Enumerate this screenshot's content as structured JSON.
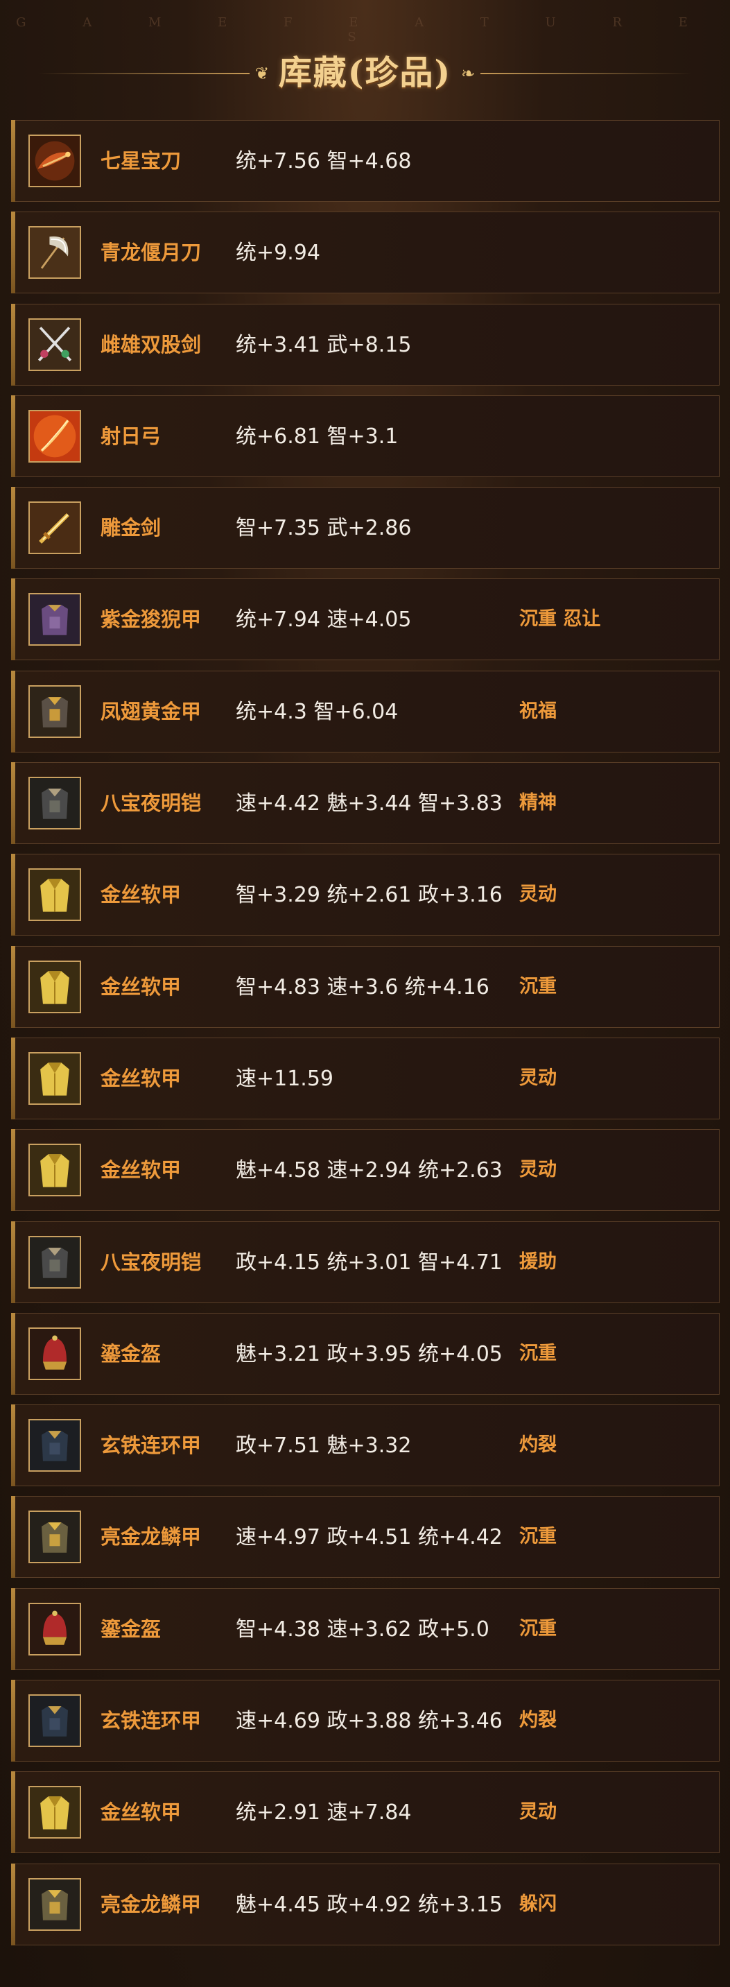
{
  "header": {
    "watermark": "G A M E   F E A T U R E S",
    "title": "库藏(珍品)"
  },
  "colors": {
    "accent_orange": "#ee9a3b",
    "title_gold": "#f3d08f",
    "stat_text": "#f2ece4",
    "border_gold": "#c9a060"
  },
  "items": [
    {
      "name": "七星宝刀",
      "stats": "统+7.56 智+4.68",
      "trait": "",
      "icon": "dragon-sword-icon"
    },
    {
      "name": "青龙偃月刀",
      "stats": "统+9.94",
      "trait": "",
      "icon": "crescent-blade-icon"
    },
    {
      "name": "雌雄双股剑",
      "stats": "统+3.41 武+8.15",
      "trait": "",
      "icon": "twin-swords-icon"
    },
    {
      "name": "射日弓",
      "stats": "统+6.81 智+3.1",
      "trait": "",
      "icon": "bow-icon"
    },
    {
      "name": "雕金剑",
      "stats": "智+7.35 武+2.86",
      "trait": "",
      "icon": "gold-sword-icon"
    },
    {
      "name": "紫金狻猊甲",
      "stats": "统+7.94 速+4.05",
      "trait": "沉重 忍让",
      "icon": "purple-armor-icon"
    },
    {
      "name": "凤翅黄金甲",
      "stats": "统+4.3 智+6.04",
      "trait": "祝福",
      "icon": "golden-armor-icon"
    },
    {
      "name": "八宝夜明铠",
      "stats": "速+4.42 魅+3.44 智+3.83",
      "trait": "精神",
      "icon": "dark-armor-icon"
    },
    {
      "name": "金丝软甲",
      "stats": "智+3.29 统+2.61 政+3.16",
      "trait": "灵动",
      "icon": "gold-vest-icon"
    },
    {
      "name": "金丝软甲",
      "stats": "智+4.83 速+3.6 统+4.16",
      "trait": "沉重",
      "icon": "gold-vest-icon"
    },
    {
      "name": "金丝软甲",
      "stats": "速+11.59",
      "trait": "灵动",
      "icon": "gold-vest-icon"
    },
    {
      "name": "金丝软甲",
      "stats": "魅+4.58 速+2.94 统+2.63",
      "trait": "灵动",
      "icon": "gold-vest-icon"
    },
    {
      "name": "八宝夜明铠",
      "stats": "政+4.15 统+3.01 智+4.71",
      "trait": "援助",
      "icon": "dark-armor-icon"
    },
    {
      "name": "鎏金盔",
      "stats": "魅+3.21 政+3.95 统+4.05",
      "trait": "沉重",
      "icon": "helmet-icon"
    },
    {
      "name": "玄铁连环甲",
      "stats": "政+7.51 魅+3.32",
      "trait": "灼裂",
      "icon": "iron-armor-icon"
    },
    {
      "name": "亮金龙鳞甲",
      "stats": "速+4.97 政+4.51 统+4.42",
      "trait": "沉重",
      "icon": "dragon-scale-armor-icon"
    },
    {
      "name": "鎏金盔",
      "stats": "智+4.38 速+3.62 政+5.0",
      "trait": "沉重",
      "icon": "helmet-icon"
    },
    {
      "name": "玄铁连环甲",
      "stats": "速+4.69 政+3.88 统+3.46",
      "trait": "灼裂",
      "icon": "iron-armor-icon"
    },
    {
      "name": "金丝软甲",
      "stats": "统+2.91 速+7.84",
      "trait": "灵动",
      "icon": "gold-vest-icon"
    },
    {
      "name": "亮金龙鳞甲",
      "stats": "魅+4.45 政+4.92 统+3.15",
      "trait": "躲闪",
      "icon": "dragon-scale-armor-icon"
    }
  ]
}
